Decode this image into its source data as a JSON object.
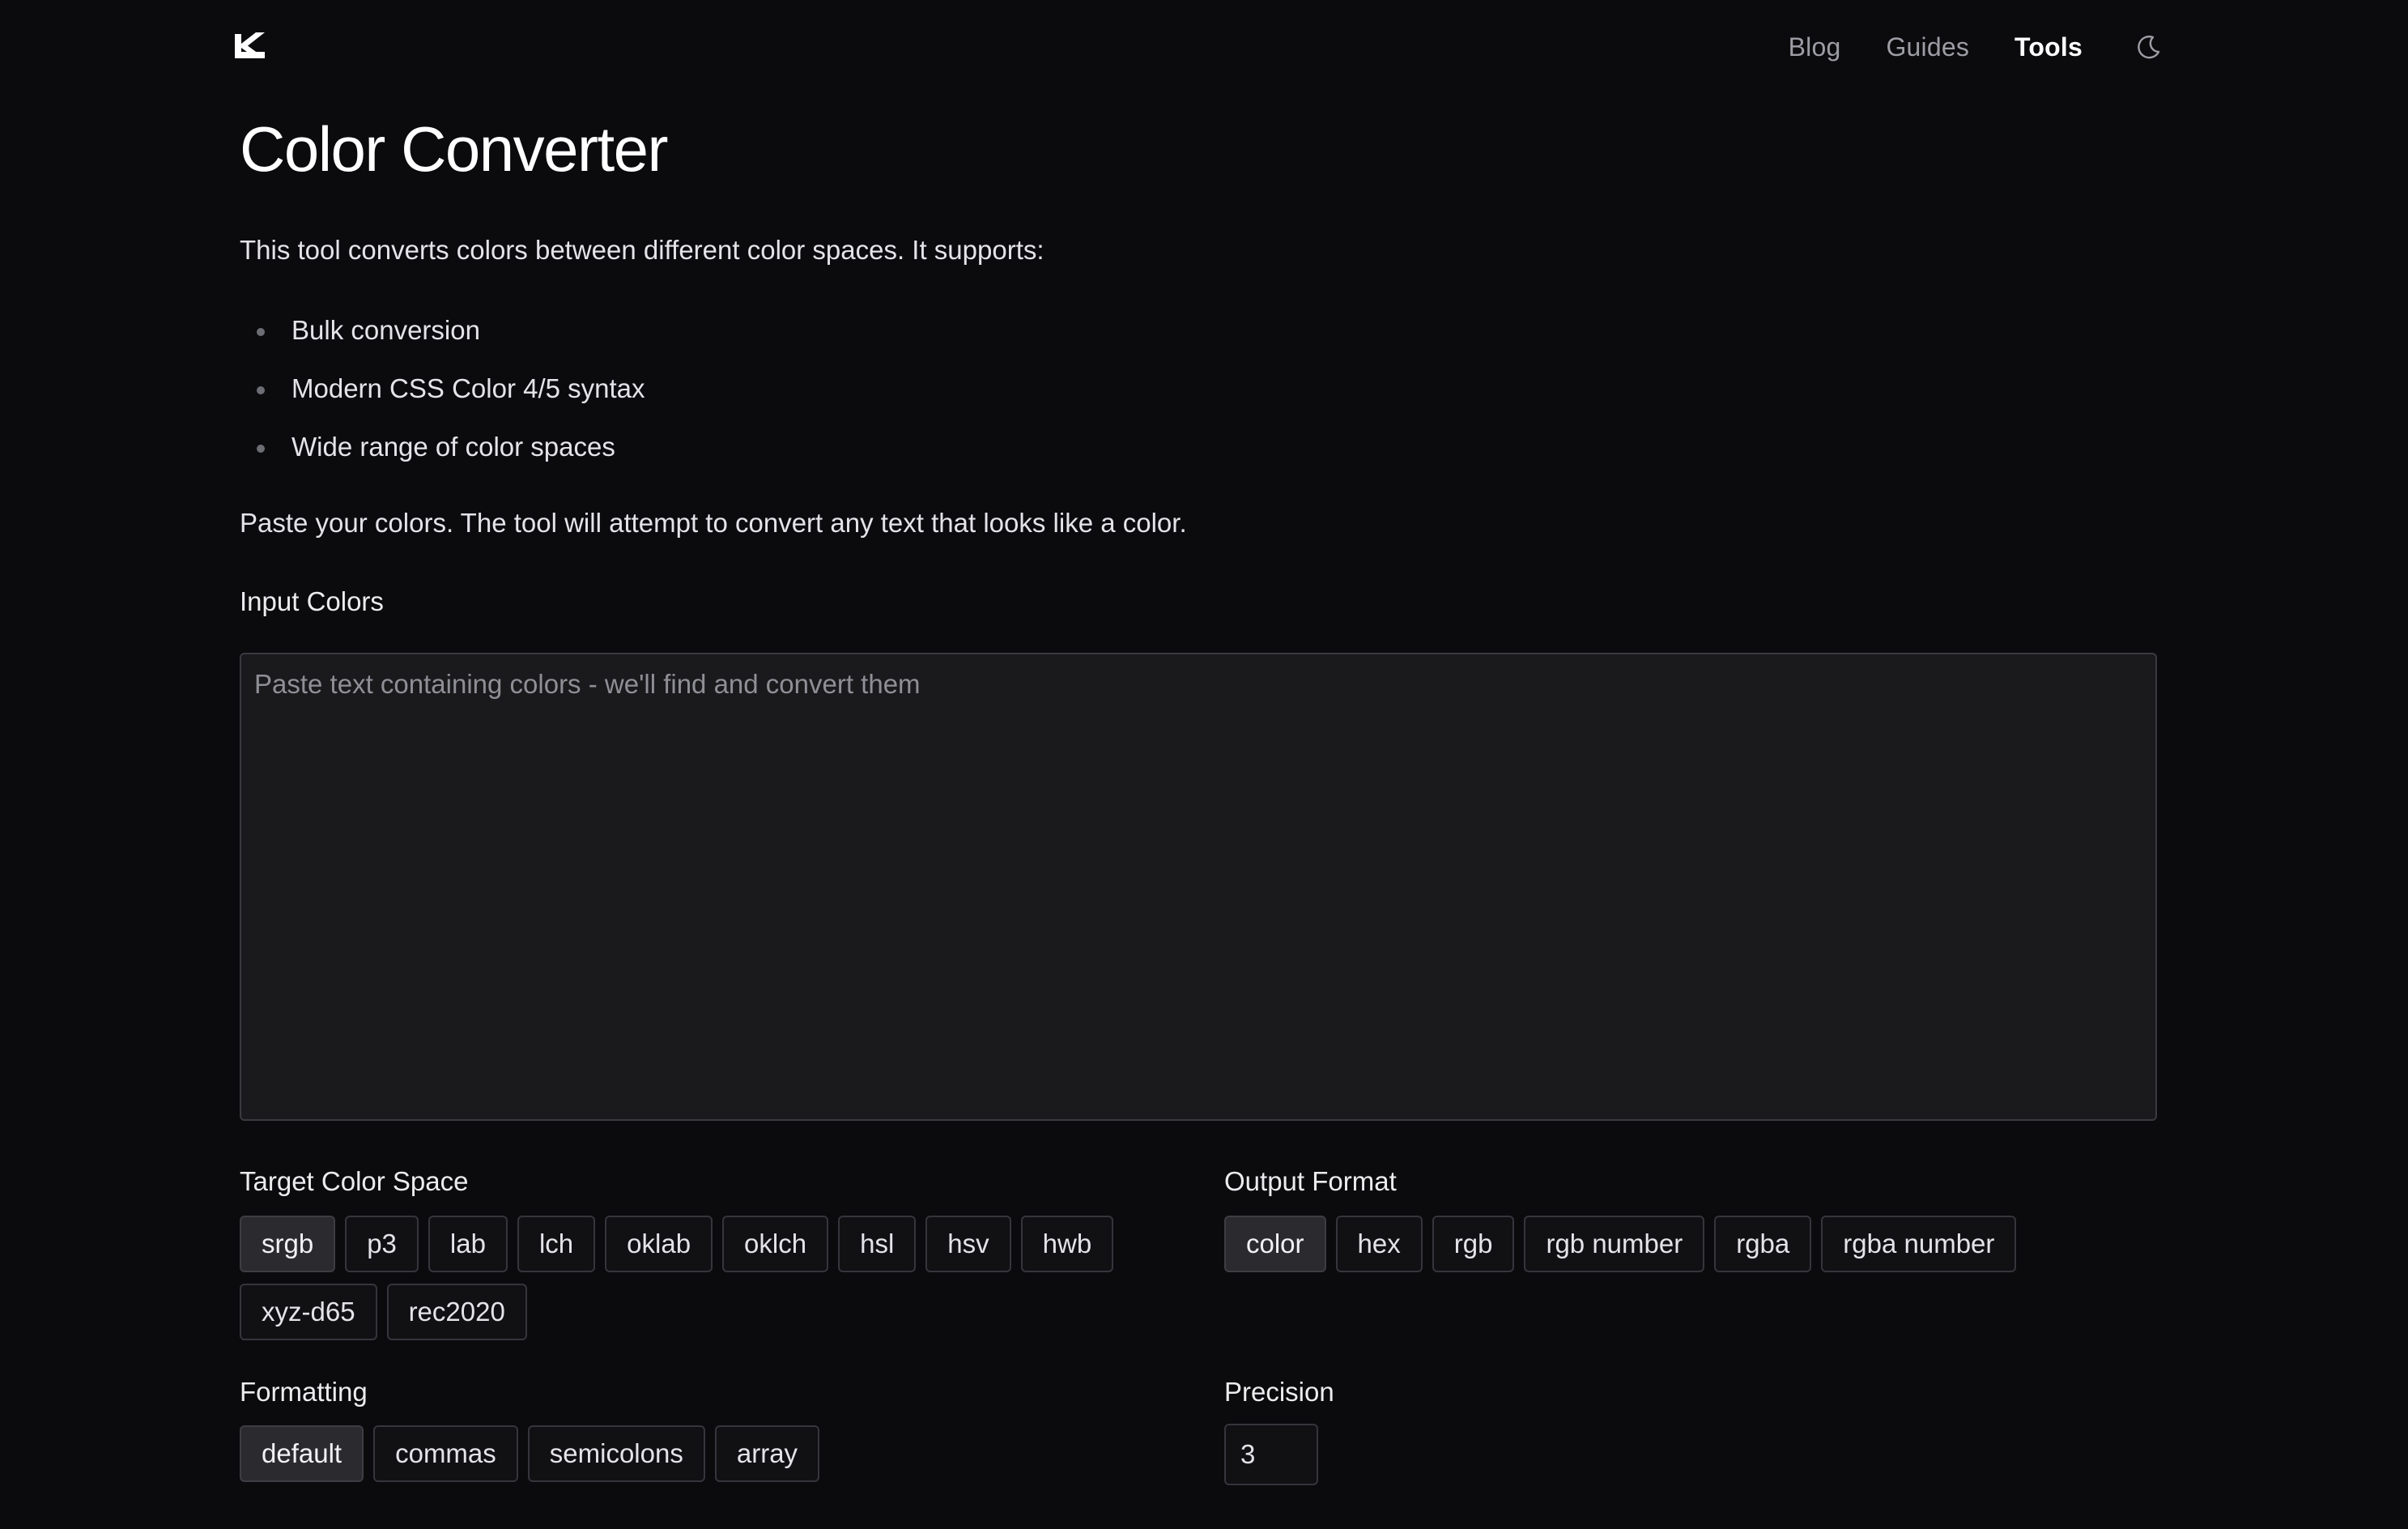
{
  "header": {
    "logo": "k-logo-icon",
    "nav": [
      {
        "label": "Blog",
        "active": false
      },
      {
        "label": "Guides",
        "active": false
      },
      {
        "label": "Tools",
        "active": true
      }
    ],
    "theme_toggle_icon": "moon-icon"
  },
  "main": {
    "title": "Color Converter",
    "intro": "This tool converts colors between different color spaces. It supports:",
    "features": [
      "Bulk conversion",
      "Modern CSS Color 4/5 syntax",
      "Wide range of color spaces"
    ],
    "paste_hint": "Paste your colors. The tool will attempt to convert any text that looks like a color.",
    "input": {
      "label": "Input Colors",
      "placeholder": "Paste text containing colors - we'll find and convert them",
      "value": ""
    },
    "target_color_space": {
      "label": "Target Color Space",
      "options": [
        "srgb",
        "p3",
        "lab",
        "lch",
        "oklab",
        "oklch",
        "hsl",
        "hsv",
        "hwb",
        "xyz-d65",
        "rec2020"
      ],
      "selected": "srgb"
    },
    "output_format": {
      "label": "Output Format",
      "options": [
        "color",
        "hex",
        "rgb",
        "rgb number",
        "rgba",
        "rgba number"
      ],
      "selected": "color"
    },
    "formatting": {
      "label": "Formatting",
      "options": [
        "default",
        "commas",
        "semicolons",
        "array"
      ],
      "selected": "default"
    },
    "precision": {
      "label": "Precision",
      "value": "3"
    }
  },
  "colors": {
    "background": "#0b0b0e",
    "text": "#ececef",
    "muted": "#9d9da5",
    "chip_bg": "#111114",
    "chip_selected_bg": "#2a2a2f",
    "border": "#35353b"
  }
}
